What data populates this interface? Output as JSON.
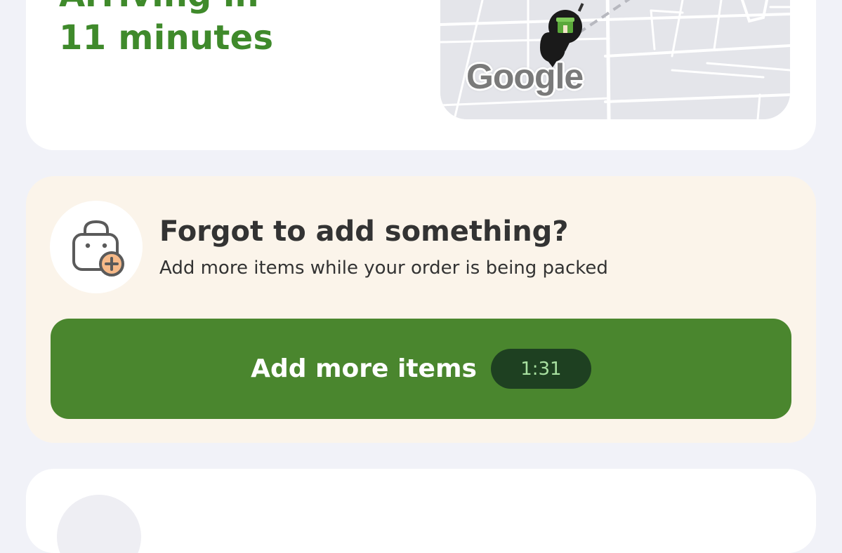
{
  "eta": {
    "line1": "Arriving in",
    "line2": "11 minutes",
    "accent_color": "#3f8a2b"
  },
  "map": {
    "attribution": "Google",
    "store_marker_icon": "store-icon"
  },
  "promo": {
    "title": "Forgot to add something?",
    "subtitle": "Add more items while your order is being packed",
    "icon": "bag-plus-icon",
    "button_label": "Add more items",
    "timer": "1:31",
    "button_color": "#4a862e",
    "timer_bg": "#1e4021"
  }
}
